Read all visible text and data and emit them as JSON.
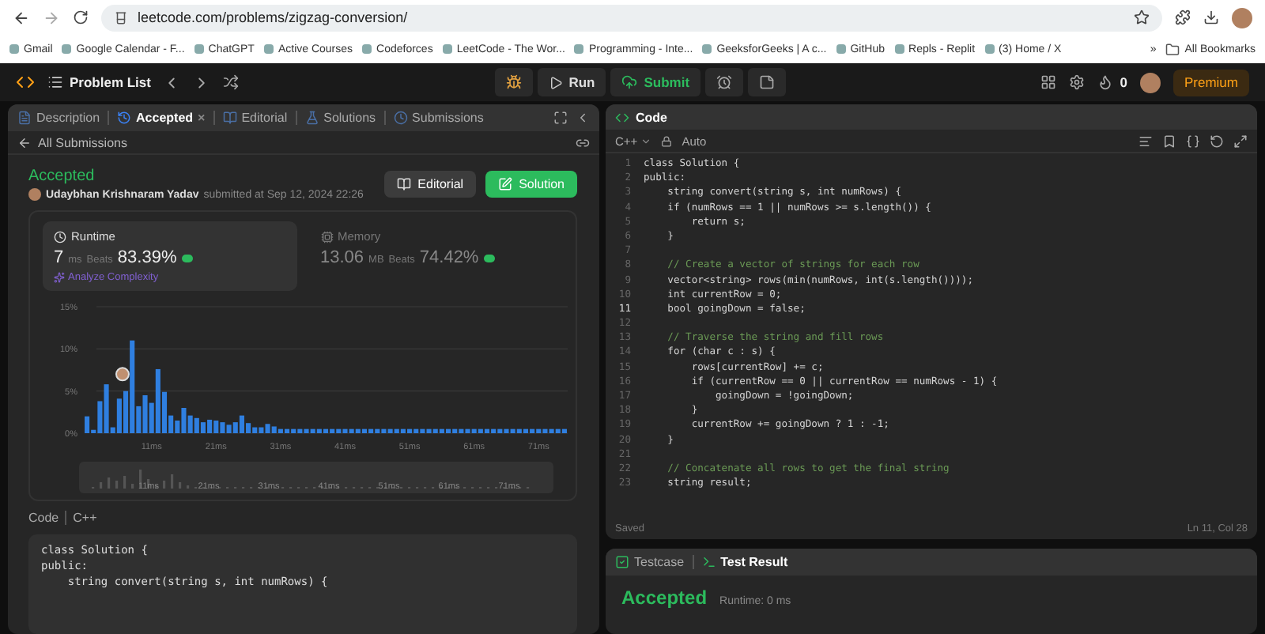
{
  "browser": {
    "url": "leetcode.com/problems/zigzag-conversion/",
    "bookmarks": [
      {
        "label": "Gmail"
      },
      {
        "label": "Google Calendar - F..."
      },
      {
        "label": "ChatGPT"
      },
      {
        "label": "Active Courses"
      },
      {
        "label": "Codeforces"
      },
      {
        "label": "LeetCode - The Wor..."
      },
      {
        "label": "Programming - Inte..."
      },
      {
        "label": "GeeksforGeeks | A c..."
      },
      {
        "label": "GitHub"
      },
      {
        "label": "Repls - Replit"
      },
      {
        "label": "(3) Home / X"
      }
    ],
    "more": "»",
    "all_bookmarks": "All Bookmarks"
  },
  "nav": {
    "problem_list": "Problem List",
    "run": "Run",
    "submit": "Submit",
    "fire_count": "0",
    "premium": "Premium"
  },
  "left": {
    "tabs": [
      {
        "label": "Description",
        "selected": false
      },
      {
        "label": "Accepted",
        "selected": true,
        "close": "×"
      },
      {
        "label": "Editorial",
        "selected": false
      },
      {
        "label": "Solutions",
        "selected": false
      },
      {
        "label": "Submissions",
        "selected": false
      }
    ],
    "back": "All Submissions",
    "status": "Accepted",
    "user": "Udaybhan Krishnaram Yadav",
    "submitted": "submitted at Sep 12, 2024 22:26",
    "editorial_button": "Editorial",
    "solution_button": "Solution",
    "stats": [
      {
        "title": "Runtime",
        "value": "7",
        "unit": "ms",
        "beats_label": "Beats",
        "beats": "83.39%",
        "selected": true,
        "link": "Analyze Complexity"
      },
      {
        "title": "Memory",
        "value": "13.06",
        "unit": "MB",
        "beats_label": "Beats",
        "beats": "74.42%",
        "selected": false
      }
    ],
    "chart_data": {
      "type": "bar",
      "x": [
        1,
        2,
        3,
        4,
        5,
        6,
        7,
        8,
        9,
        10,
        11,
        12,
        13,
        14,
        15,
        16,
        17,
        18,
        19,
        20,
        21,
        22,
        23,
        24,
        25,
        26,
        27,
        28,
        29,
        30,
        31,
        32,
        33,
        34,
        35,
        36,
        37,
        38,
        39,
        40,
        41,
        42,
        43,
        44,
        45,
        46,
        47,
        48,
        49,
        50,
        51,
        52,
        53,
        54,
        55,
        56,
        57,
        58,
        59,
        60,
        61,
        62,
        63,
        64,
        65,
        66,
        67,
        68,
        69,
        70,
        71,
        72,
        73,
        74,
        75
      ],
      "values": [
        2.0,
        0.4,
        3.8,
        5.8,
        0.7,
        4.1,
        5.0,
        11.0,
        3.2,
        4.5,
        3.6,
        7.6,
        4.9,
        2.1,
        1.5,
        3.0,
        2.1,
        1.8,
        1.3,
        1.6,
        1.5,
        1.3,
        1.0,
        1.3,
        2.1,
        1.2,
        0.7,
        0.7,
        1.1,
        0.8,
        0.5,
        0.5,
        0.5,
        0.5,
        0.5,
        0.5,
        0.5,
        0.5,
        0.5,
        0.5,
        0.5,
        0.5,
        0.5,
        0.5,
        0.5,
        0.5,
        0.5,
        0.5,
        0.5,
        0.5,
        0.5,
        0.5,
        0.5,
        0.5,
        0.5,
        0.5,
        0.5,
        0.5,
        0.5,
        0.5,
        0.5,
        0.5,
        0.5,
        0.5,
        0.5,
        0.5,
        0.5,
        0.5,
        0.5,
        0.5,
        0.5,
        0.5,
        0.5,
        0.5,
        0.5
      ],
      "xlim": [
        0.5,
        75.5
      ],
      "ylim": [
        0,
        15
      ],
      "xticks": [
        {
          "value": 11,
          "label": "11ms"
        },
        {
          "value": 21,
          "label": "21ms"
        },
        {
          "value": 31,
          "label": "31ms"
        },
        {
          "value": 41,
          "label": "41ms"
        },
        {
          "value": 51,
          "label": "51ms"
        },
        {
          "value": 61,
          "label": "61ms"
        },
        {
          "value": 71,
          "label": "71ms"
        }
      ],
      "yticks": [
        {
          "value": 0,
          "label": "0%"
        },
        {
          "value": 5,
          "label": "5%"
        },
        {
          "value": 10,
          "label": "10%"
        },
        {
          "value": 15,
          "label": "15%"
        }
      ]
    },
    "overview_labels": [
      "11ms",
      "21ms",
      "31ms",
      "41ms",
      "51ms",
      "61ms",
      "71ms"
    ],
    "code_label": "Code",
    "code_lang": "C++",
    "code": [
      "class Solution {",
      "public:",
      "    string convert(string s, int numRows) {"
    ]
  },
  "editor": {
    "title": "Code",
    "language": "C++",
    "mode": "Auto",
    "lines": [
      {
        "number": "1",
        "text": "class Solution {",
        "kind": "code",
        "active": false
      },
      {
        "number": "2",
        "text": "public:",
        "kind": "code",
        "active": false
      },
      {
        "number": "3",
        "text": "    string convert(string s, int numRows) {",
        "kind": "code",
        "active": false
      },
      {
        "number": "4",
        "text": "    if (numRows == 1 || numRows >= s.length()) {",
        "kind": "code",
        "active": false
      },
      {
        "number": "5",
        "text": "        return s;",
        "kind": "code",
        "active": false
      },
      {
        "number": "6",
        "text": "    }",
        "kind": "code",
        "active": false
      },
      {
        "number": "7",
        "active": false
      },
      {
        "number": "8",
        "text": "    // Create a vector of strings for each row",
        "kind": "comment",
        "active": false
      },
      {
        "number": "9",
        "text": "    vector<string> rows(min(numRows, int(s.length())));",
        "kind": "code",
        "active": false
      },
      {
        "number": "10",
        "text": "    int currentRow = 0;",
        "kind": "code",
        "active": false
      },
      {
        "number": "11",
        "text": "    bool goingDown = false;",
        "kind": "code",
        "active": true
      },
      {
        "number": "12",
        "active": false
      },
      {
        "number": "13",
        "text": "    // Traverse the string and fill rows",
        "kind": "comment",
        "active": false
      },
      {
        "number": "14",
        "text": "    for (char c : s) {",
        "kind": "code",
        "active": false
      },
      {
        "number": "15",
        "text": "        rows[currentRow] += c;",
        "kind": "code",
        "active": false
      },
      {
        "number": "16",
        "text": "        if (currentRow == 0 || currentRow == numRows - 1) {",
        "kind": "code",
        "active": false
      },
      {
        "number": "17",
        "text": "            goingDown = !goingDown;",
        "kind": "code",
        "active": false
      },
      {
        "number": "18",
        "text": "        }",
        "kind": "code",
        "active": false
      },
      {
        "number": "19",
        "text": "        currentRow += goingDown ? 1 : -1;",
        "kind": "code",
        "active": false
      },
      {
        "number": "20",
        "text": "    }",
        "kind": "code",
        "active": false
      },
      {
        "number": "21",
        "active": false
      },
      {
        "number": "22",
        "text": "    // Concatenate all rows to get the final string",
        "kind": "comment",
        "active": false
      },
      {
        "number": "23",
        "text": "    string result;",
        "kind": "code",
        "active": false
      }
    ],
    "status": "Saved",
    "cursor": "Ln 11, Col 28"
  },
  "result": {
    "tabs": [
      {
        "label": "Testcase",
        "selected": false
      },
      {
        "label": "Test Result",
        "selected": true
      }
    ],
    "verdict": "Accepted",
    "runtime": "Runtime: 0 ms"
  }
}
